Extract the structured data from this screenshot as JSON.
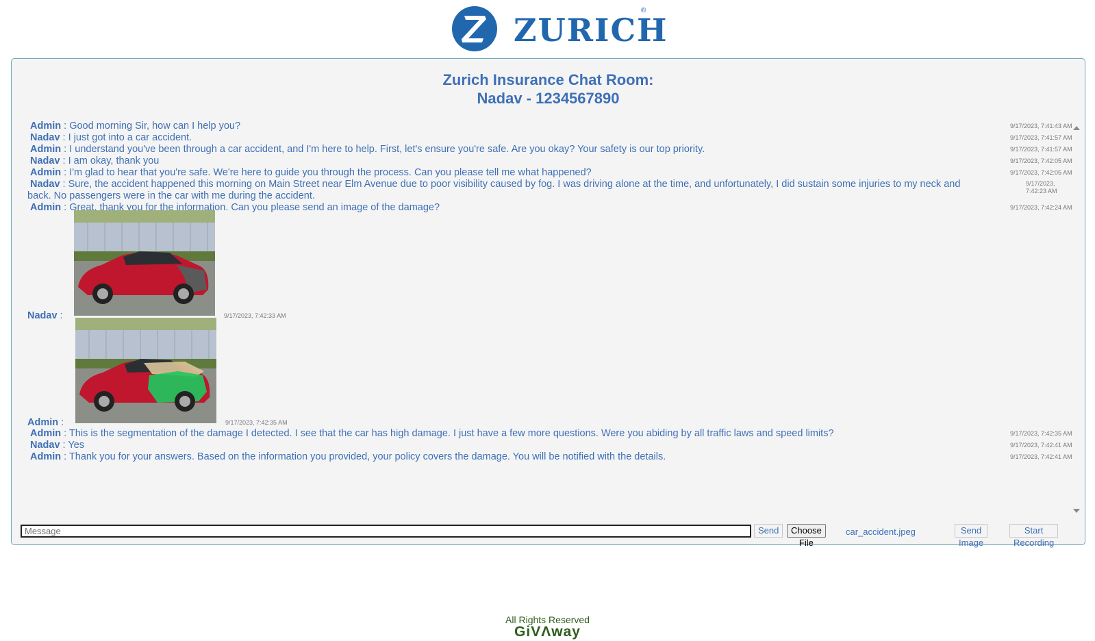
{
  "brand": {
    "logo_letter": "Z",
    "name": "ZURICH",
    "registered": "®",
    "color": "#2167ae"
  },
  "room": {
    "title_line1": "Zurich Insurance Chat Room:",
    "title_line2": "Nadav - 1234567890"
  },
  "messages": [
    {
      "sender": "Admin",
      "text": " : Good morning Sir, how can I help you?",
      "time": "9/17/2023, 7:41:43 AM"
    },
    {
      "sender": "Nadav",
      "text": " : I just got into a car accident.",
      "time": "9/17/2023, 7:41:57 AM"
    },
    {
      "sender": "Admin",
      "text": " : I understand you've been through a car accident, and I'm here to help. First, let's ensure you're safe. Are you okay? Your safety is our top priority.",
      "time": "9/17/2023, 7:41:57 AM"
    },
    {
      "sender": "Nadav",
      "text": " : I am okay, thank you",
      "time": "9/17/2023, 7:42:05 AM"
    },
    {
      "sender": "Admin",
      "text": " : I'm glad to hear that you're safe. We're here to guide you through the process. Can you please tell me what happened?",
      "time": "9/17/2023, 7:42:05 AM"
    },
    {
      "sender": "Nadav",
      "text": " : Sure, the accident happened this morning on Main Street near Elm Avenue due to poor visibility caused by fog. I was driving alone at the time, and unfortunately, I did sustain some injuries to my neck and back. No passengers were in the car with me during the accident.",
      "time": "9/17/2023, 7:42:23 AM"
    },
    {
      "sender": "Admin",
      "text": " : Great, thank you for the information. Can you please send an image of the damage?",
      "time": "9/17/2023, 7:42:24 AM"
    },
    {
      "sender": "Nadav",
      "text": " :",
      "time": "9/17/2023, 7:42:33 AM",
      "image": "damaged red car photo"
    },
    {
      "sender": "Admin",
      "text": " :",
      "time": "9/17/2023, 7:42:35 AM",
      "image": "damage segmentation overlay photo"
    },
    {
      "sender": "Admin",
      "text": " : This is the segmentation of the damage I detected. I see that the car has high damage. I just have a few more questions. Were you abiding by all traffic laws and speed limits?",
      "time": "9/17/2023, 7:42:35 AM"
    },
    {
      "sender": "Nadav",
      "text": " : Yes",
      "time": "9/17/2023, 7:42:41 AM"
    },
    {
      "sender": "Admin",
      "text": " : Thank you for your answers. Based on the information you provided, your policy covers the damage. You will be notified with the details.",
      "time": "9/17/2023, 7:42:41 AM"
    }
  ],
  "composer": {
    "placeholder": "Message",
    "send_label": "Send",
    "choose_file_label": "Choose File",
    "file_name": "car_accident.jpeg",
    "send_image_label": "Send Image",
    "record_label": "Start Recording"
  },
  "footer": {
    "rights": "All Rights Reserved",
    "brand": "GiVΛway"
  },
  "colors": {
    "accent": "#3e70b6",
    "footer": "#2e5d1d",
    "panel_bg": "#f4f4f4",
    "segmentation": "#22c55e"
  },
  "icons": [
    "scroll-up-icon",
    "scroll-down-icon"
  ]
}
